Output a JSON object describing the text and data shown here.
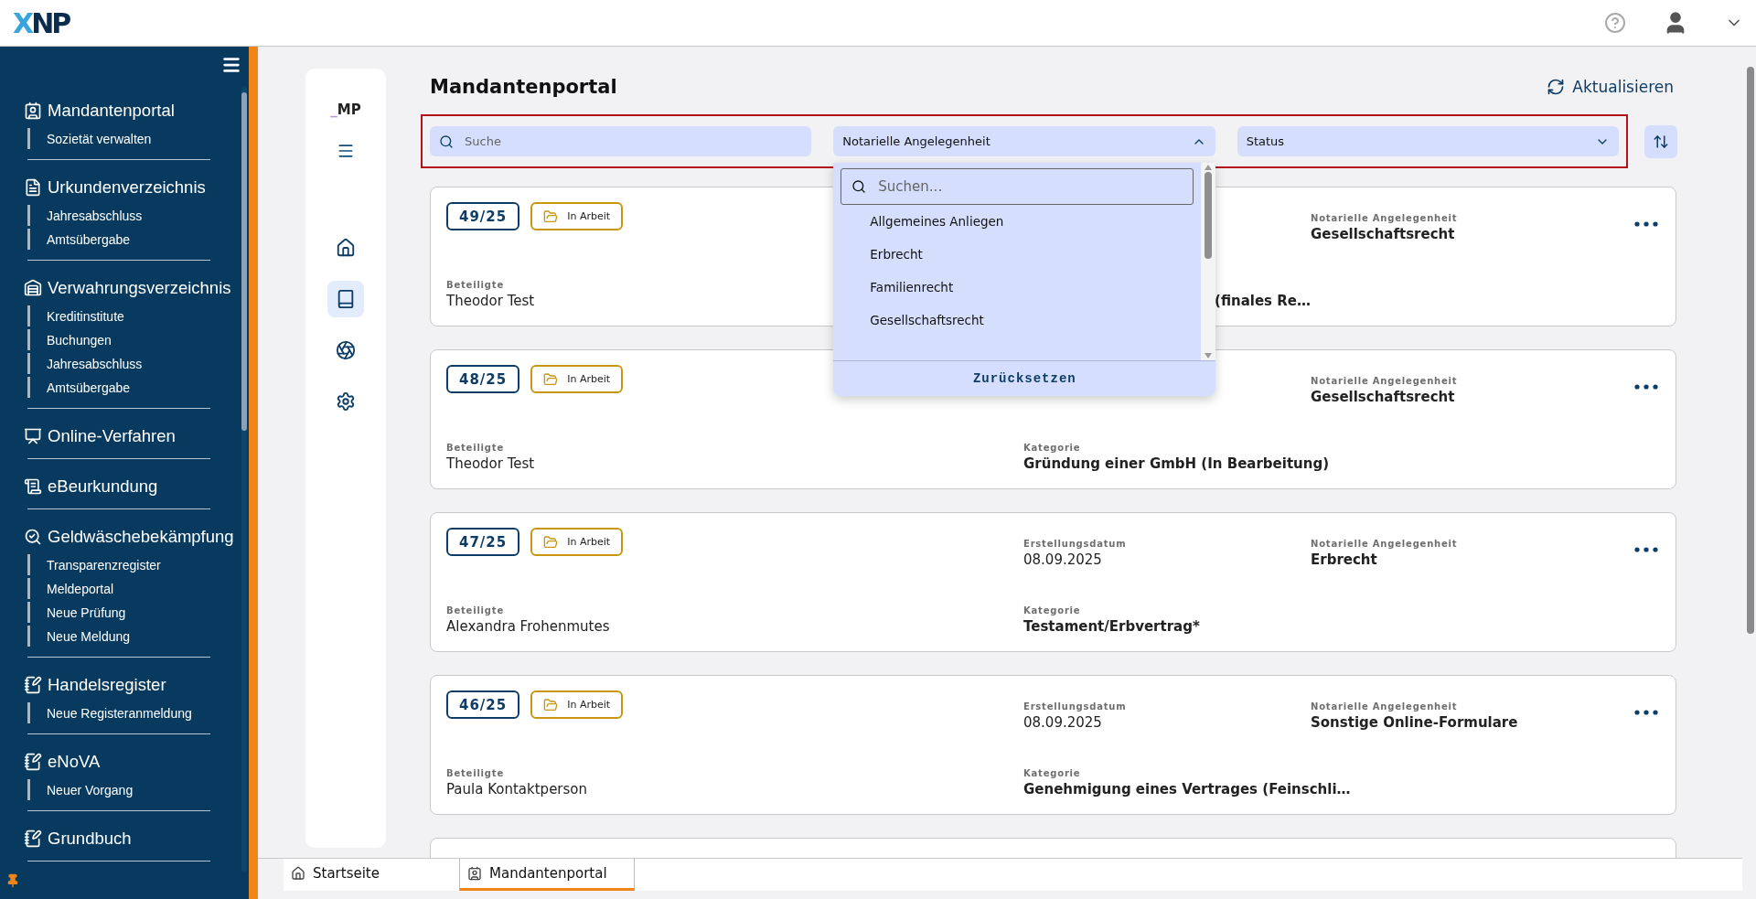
{
  "header": {
    "logo": [
      "X",
      "NP"
    ]
  },
  "sidebar": {
    "sections": [
      {
        "title": "Mandantenportal",
        "children": [
          {
            "label": "Sozietät verwalten"
          }
        ]
      },
      {
        "title": "Urkundenverzeichnis",
        "children": [
          {
            "label": "Jahresabschluss"
          },
          {
            "label": "Amtsübergabe"
          }
        ]
      },
      {
        "title": "Verwahrungsverzeichnis",
        "children": [
          {
            "label": "Kreditinstitute"
          },
          {
            "label": "Buchungen"
          },
          {
            "label": "Jahresabschluss"
          },
          {
            "label": "Amtsübergabe"
          }
        ]
      },
      {
        "title": "Online-Verfahren"
      },
      {
        "title": "eBeurkundung"
      },
      {
        "title": "Geldwäschebekämpfung",
        "children": [
          {
            "label": "Transparenzregister"
          },
          {
            "label": "Meldeportal"
          },
          {
            "label": "Neue Prüfung"
          },
          {
            "label": "Neue Meldung"
          }
        ]
      },
      {
        "title": "Handelsregister",
        "children": [
          {
            "label": "Neue Registeranmeldung"
          }
        ]
      },
      {
        "title": "eNoVA",
        "children": [
          {
            "label": "Neuer Vorgang"
          }
        ]
      },
      {
        "title": "Grundbuch"
      }
    ]
  },
  "rail": {
    "logo": "_MP",
    "items": [
      {
        "selected": false
      },
      {
        "selected": true
      },
      {
        "selected": false
      },
      {
        "selected": false
      }
    ]
  },
  "page": {
    "title": "Mandantenportal",
    "refresh": "Aktualisieren"
  },
  "filters": {
    "search": {
      "placeholder": "Suche"
    },
    "matter": {
      "label": "Notarielle Angelegenheit",
      "expanded": true
    },
    "status": {
      "label": "Status",
      "expanded": false
    }
  },
  "dropdown": {
    "search_placeholder": "Suchen...",
    "options": [
      {
        "label": "Allgemeines Anliegen",
        "selected": false
      },
      {
        "label": "Erbrecht",
        "selected": false
      },
      {
        "label": "Familienrecht",
        "selected": false
      },
      {
        "label": "Gesellschaftsrecht",
        "selected": false
      }
    ],
    "reset": "Zurücksetzen"
  },
  "cards": [
    {
      "number": "49/25",
      "status": "In Arbeit",
      "participants_label": "Beteiligte",
      "participants": "Theodor Test",
      "matter_label": "Notarielle Angelegenheit",
      "matter": "Gesellschaftsrecht",
      "category": "(finales Re…"
    },
    {
      "number": "48/25",
      "status": "In Arbeit",
      "participants_label": "Beteiligte",
      "participants": "Theodor Test",
      "matter_label": "Notarielle Angelegenheit",
      "matter": "Gesellschaftsrecht",
      "category_label": "Kategorie",
      "category": "Gründung einer GmbH (In Bearbeitung)"
    },
    {
      "number": "47/25",
      "status": "In Arbeit",
      "participants_label": "Beteiligte",
      "participants": "Alexandra Frohenmutes",
      "date_label": "Erstellungsdatum",
      "date": "08.09.2025",
      "matter_label": "Notarielle Angelegenheit",
      "matter": "Erbrecht",
      "category_label": "Kategorie",
      "category": "Testament/Erbvertrag*"
    },
    {
      "number": "46/25",
      "status": "In Arbeit",
      "participants_label": "Beteiligte",
      "participants": "Paula Kontaktperson",
      "date_label": "Erstellungsdatum",
      "date": "08.09.2025",
      "matter_label": "Notarielle Angelegenheit",
      "matter": "Sonstige Online-Formulare",
      "category_label": "Kategorie",
      "category": "Genehmigung eines Vertrages (Feinschli…"
    }
  ],
  "tabs": [
    {
      "label": "Startseite",
      "selected": false
    },
    {
      "label": "Mandantenportal",
      "selected": true
    }
  ]
}
